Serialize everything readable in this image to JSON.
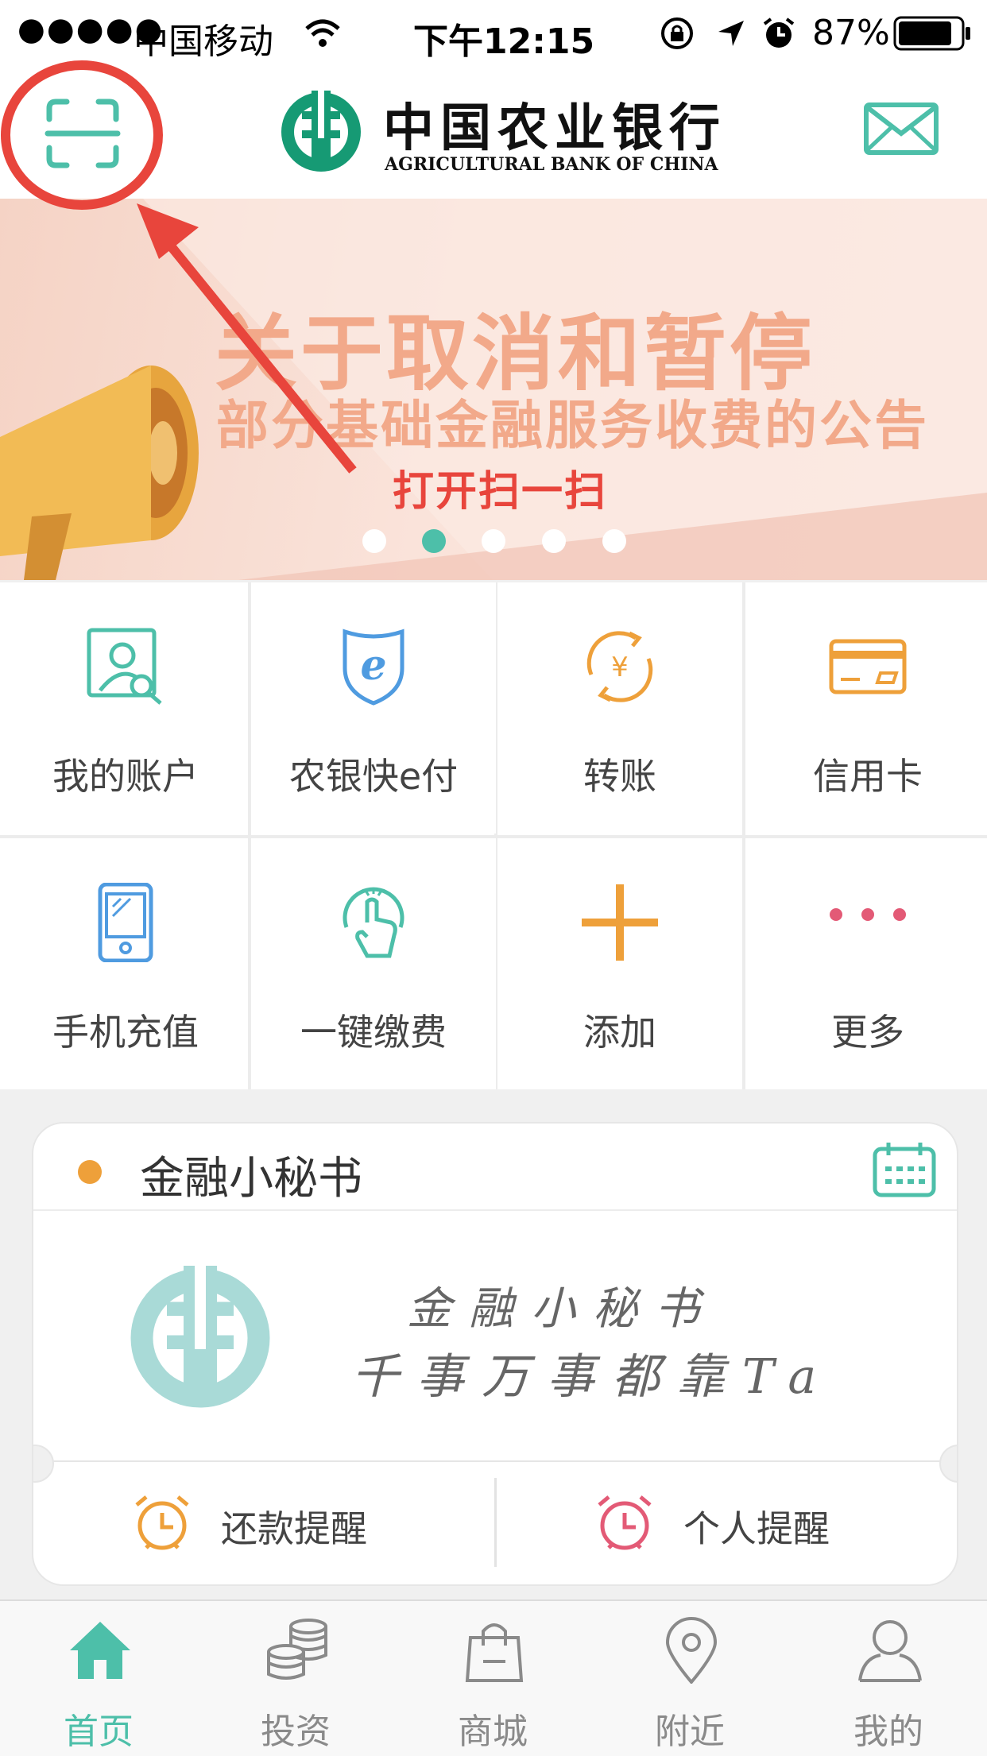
{
  "status_bar": {
    "signal": "●●●●●",
    "carrier": "中国移动",
    "time": "下午12:15",
    "battery": "87%"
  },
  "header": {
    "bank_name_cn": "中国农业银行",
    "bank_name_en": "AGRICULTURAL BANK OF CHINA"
  },
  "banner": {
    "line1": "关于取消和暂停",
    "line2": "部分基础金融服务收费的公告",
    "annotation": "打开扫一扫",
    "active_dot": 1,
    "dot_count": 5
  },
  "grid": {
    "items": [
      {
        "label": "我的账户",
        "icon": "account-search-icon"
      },
      {
        "label": "农银快e付",
        "icon": "e-pay-shield-icon"
      },
      {
        "label": "转账",
        "icon": "transfer-yuan-icon"
      },
      {
        "label": "信用卡",
        "icon": "credit-card-icon"
      },
      {
        "label": "手机充值",
        "icon": "phone-recharge-icon"
      },
      {
        "label": "一键缴费",
        "icon": "tap-pay-icon"
      },
      {
        "label": "添加",
        "icon": "plus-icon"
      },
      {
        "label": "更多",
        "icon": "more-dots-icon"
      }
    ]
  },
  "secretary": {
    "title": "金融小秘书",
    "handwriting_line1": "金融小秘书",
    "handwriting_line2": "千事万事都靠Ta",
    "reminders": [
      {
        "label": "还款提醒",
        "icon": "alarm-clock-icon"
      },
      {
        "label": "个人提醒",
        "icon": "alarm-clock-icon"
      }
    ]
  },
  "tabbar": {
    "items": [
      {
        "label": "首页",
        "icon": "home-icon",
        "active": true
      },
      {
        "label": "投资",
        "icon": "coins-icon",
        "active": false
      },
      {
        "label": "商城",
        "icon": "shopping-bag-icon",
        "active": false
      },
      {
        "label": "附近",
        "icon": "location-pin-icon",
        "active": false
      },
      {
        "label": "我的",
        "icon": "user-icon",
        "active": false
      }
    ]
  },
  "colors": {
    "accent": "#4dbfa9",
    "orange": "#eea03a",
    "blue": "#4f9be0",
    "pink": "#e35a76",
    "annotation_red": "#e8453c"
  }
}
